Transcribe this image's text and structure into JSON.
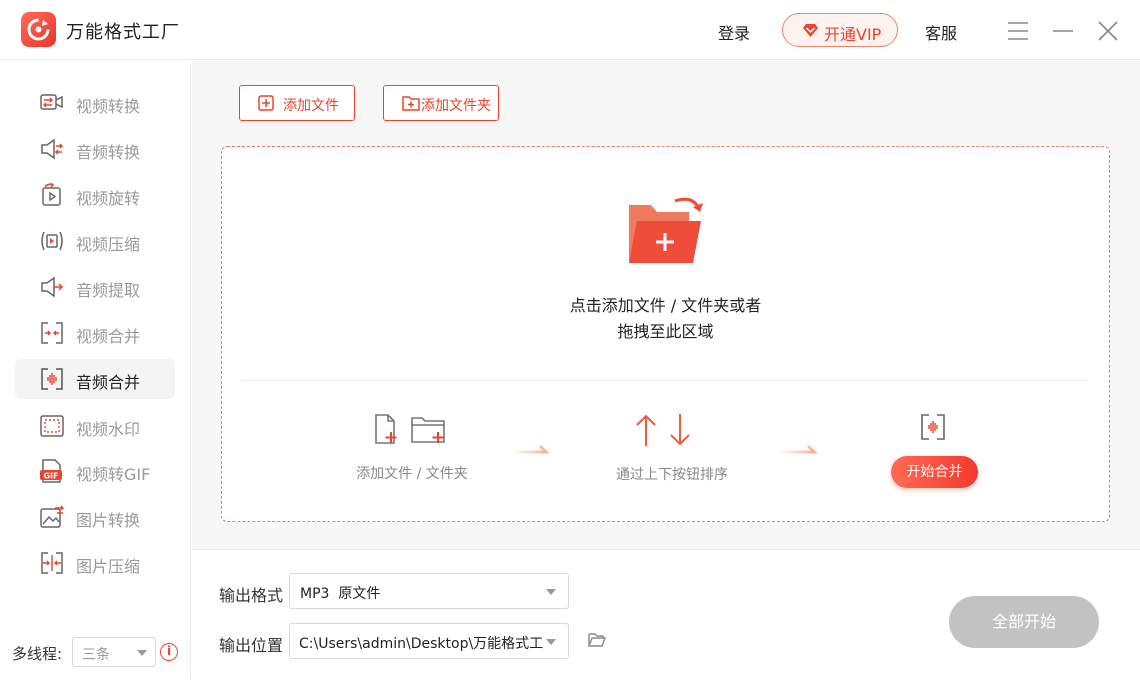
{
  "app": {
    "title": "万能格式工厂"
  },
  "header": {
    "login_label": "登录",
    "vip_label": "开通VIP",
    "service_label": "客服"
  },
  "sidebar": {
    "items": [
      {
        "label": "视频转换",
        "icon": "video-convert-icon",
        "active": false
      },
      {
        "label": "音频转换",
        "icon": "audio-convert-icon",
        "active": false
      },
      {
        "label": "视频旋转",
        "icon": "video-rotate-icon",
        "active": false
      },
      {
        "label": "视频压缩",
        "icon": "video-compress-icon",
        "active": false
      },
      {
        "label": "音频提取",
        "icon": "audio-extract-icon",
        "active": false
      },
      {
        "label": "视频合并",
        "icon": "video-merge-icon",
        "active": false
      },
      {
        "label": "音频合并",
        "icon": "audio-merge-icon",
        "active": true
      },
      {
        "label": "视频水印",
        "icon": "video-watermark-icon",
        "active": false
      },
      {
        "label": "视频转GIF",
        "icon": "video-to-gif-icon",
        "active": false
      },
      {
        "label": "图片转换",
        "icon": "image-convert-icon",
        "active": false
      },
      {
        "label": "图片压缩",
        "icon": "image-compress-icon",
        "active": false
      }
    ],
    "threads_label": "多线程:",
    "threads_value": "三条",
    "info_glyph": "i"
  },
  "main": {
    "add_file_label": "添加文件",
    "add_folder_label": "添加文件夹",
    "drop_line1": "点击添加文件 / 文件夹或者",
    "drop_line2": "拖拽至此区域",
    "step1_label": "添加文件 / 文件夹",
    "step2_label": "通过上下按钮排序",
    "start_merge_label": "开始合并"
  },
  "bottom": {
    "format_label": "输出格式",
    "format_value": "MP3  原文件",
    "path_label": "输出位置",
    "path_value": "C:\\Users\\admin\\Desktop\\万能格式工厂",
    "start_all_label": "全部开始"
  },
  "colors": {
    "accent": "#e8452f",
    "disabled": "#c2c2c2"
  }
}
